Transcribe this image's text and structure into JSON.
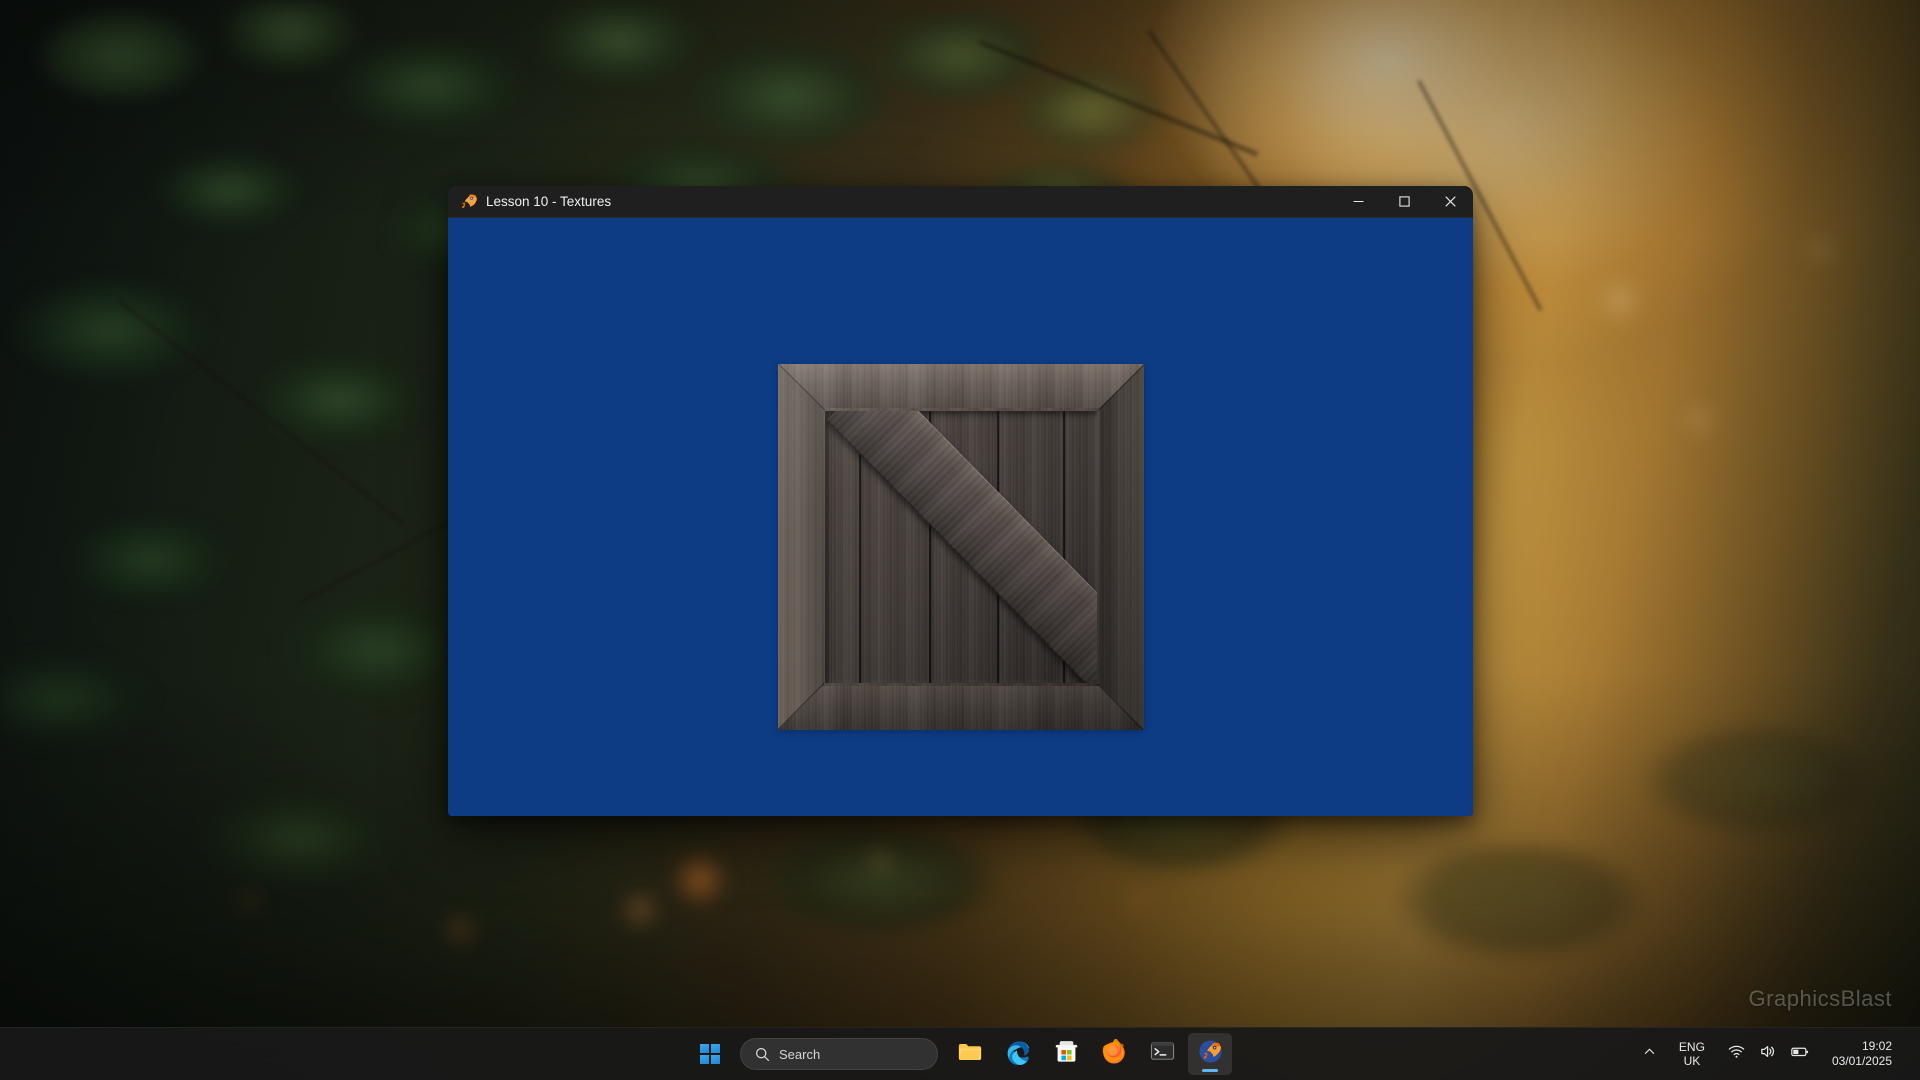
{
  "desktop": {
    "wallpaper_description": "blurred golden-hour forest foliage",
    "watermark": "GraphicsBlast"
  },
  "window": {
    "title": "Lesson 10 - Textures",
    "app_icon": "rocket-icon",
    "titlebar_color": "#1f1f1f",
    "controls": {
      "minimize_label": "Minimize",
      "maximize_label": "Maximize",
      "close_label": "Close"
    },
    "canvas": {
      "clear_color": "#0d3c85",
      "object": "textured wooden crate quad",
      "texture_name": "crate wood texture"
    }
  },
  "taskbar": {
    "start_label": "Start",
    "search": {
      "placeholder": "Search",
      "value": "",
      "icon": "search-icon"
    },
    "items": [
      {
        "name": "file-explorer",
        "label": "File Explorer",
        "active": false
      },
      {
        "name": "edge",
        "label": "Microsoft Edge",
        "active": false
      },
      {
        "name": "store",
        "label": "Microsoft Store",
        "active": false
      },
      {
        "name": "firefox",
        "label": "Firefox",
        "active": false
      },
      {
        "name": "terminal",
        "label": "Terminal",
        "active": false
      },
      {
        "name": "lesson-app",
        "label": "Lesson 10 - Textures",
        "active": true
      }
    ],
    "tray": {
      "overflow_label": "Show hidden icons",
      "language_primary": "ENG",
      "language_secondary": "UK",
      "network_label": "Network",
      "volume_label": "Volume",
      "battery_label": "Battery",
      "time": "19:02",
      "date": "03/01/2025"
    }
  }
}
